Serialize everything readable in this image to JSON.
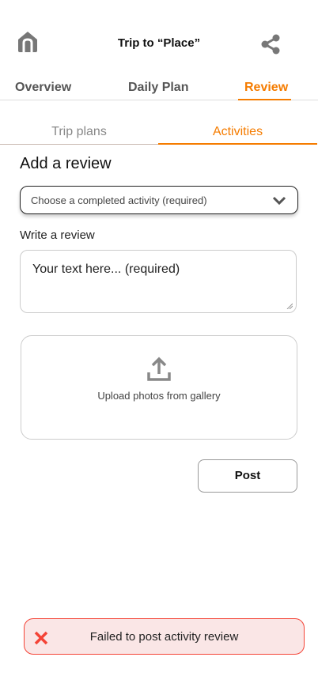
{
  "header": {
    "title": "Trip to “Place”"
  },
  "tabs": [
    {
      "label": "Overview"
    },
    {
      "label": "Daily Plan"
    },
    {
      "label": "Review",
      "active": true
    }
  ],
  "subtabs": [
    {
      "label": "Trip plans"
    },
    {
      "label": "Activities",
      "active": true
    }
  ],
  "form": {
    "heading": "Add a review",
    "activity_placeholder": "Choose a completed activity (required)",
    "review_label": "Write a review",
    "review_placeholder": "Your text here... (required)",
    "upload_label": "Upload photos from gallery",
    "post_label": "Post"
  },
  "toast": {
    "message": "Failed to post activity review"
  },
  "colors": {
    "accent": "#f57c00",
    "error": "#f44336",
    "error_bg": "#fae6e6"
  }
}
